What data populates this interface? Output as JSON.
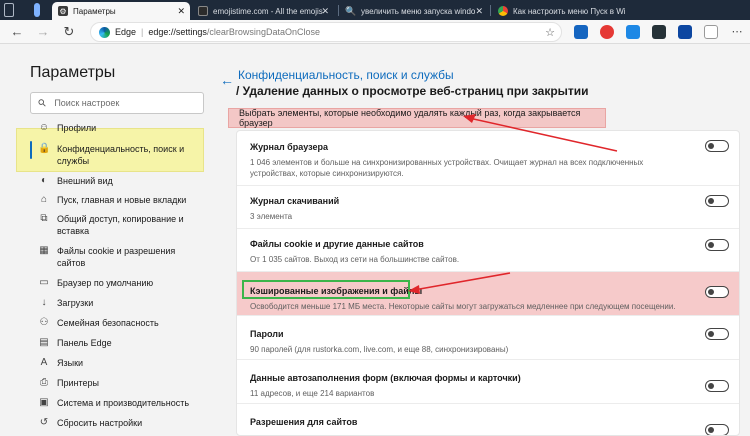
{
  "browser": {
    "tabs": [
      {
        "label": "Параметры",
        "active": true
      },
      {
        "label": "emojistime.com - All the emojis",
        "active": false
      },
      {
        "label": "увеличить меню запуска windo",
        "active": false
      },
      {
        "label": "Как настроить меню Пуск в Wi",
        "active": false
      }
    ],
    "address": {
      "scheme": "Edge",
      "url_host": "edge://settings",
      "url_path": "/clearBrowsingDataOnClose"
    },
    "icons": [
      "back-icon",
      "forward-icon",
      "refresh-icon",
      "home-icon",
      "star-icon",
      "shield-icon",
      "extensions-icon"
    ]
  },
  "settings_nav": {
    "title": "Параметры",
    "search_placeholder": "Поиск настроек",
    "items": [
      {
        "label": "Профили",
        "icon": "person-icon"
      },
      {
        "label": "Конфиденциальность, поиск и службы",
        "icon": "lock-icon"
      },
      {
        "label": "Внешний вид",
        "icon": "appearance-icon"
      },
      {
        "label": "Пуск, главная и новые вкладки",
        "icon": "home-icon"
      },
      {
        "label": "Общий доступ, копирование и вставка",
        "icon": "share-icon"
      },
      {
        "label": "Файлы cookie и разрешения сайтов",
        "icon": "cookie-icon"
      },
      {
        "label": "Браузер по умолчанию",
        "icon": "browser-icon"
      },
      {
        "label": "Загрузки",
        "icon": "download-icon"
      },
      {
        "label": "Семейная безопасность",
        "icon": "family-icon"
      },
      {
        "label": "Панель Edge",
        "icon": "panel-icon"
      },
      {
        "label": "Языки",
        "icon": "language-icon"
      },
      {
        "label": "Принтеры",
        "icon": "printer-icon"
      },
      {
        "label": "Система и производительность",
        "icon": "system-icon"
      },
      {
        "label": "Сбросить настройки",
        "icon": "reset-icon"
      }
    ]
  },
  "main": {
    "breadcrumb": "Конфиденциальность, поиск и службы",
    "page_title": "/ Удаление данных о просмотре веб-страниц при закрытии",
    "instruction": "Выбрать элементы, которые необходимо удалять каждый раз, когда закрывается браузер",
    "rows": [
      {
        "title": "Журнал браузера",
        "desc": "1 046 элементов и больше на синхронизированных устройствах. Очищает журнал на всех подключенных устройствах, которые синхронизируются.",
        "on": false
      },
      {
        "title": "Журнал скачиваний",
        "desc": "3 элемента",
        "on": false
      },
      {
        "title": "Файлы cookie и другие данные сайтов",
        "desc": "От 1 035 сайтов. Выход из сети на большинстве сайтов.",
        "on": false
      },
      {
        "title": "Кэшированные изображения и файлы",
        "desc": "Освободится меньше 171 МБ места. Некоторые сайты могут загружаться медленнее при следующем посещении.",
        "on": false
      },
      {
        "title": "Пароли",
        "desc": "90 паролей (для rustorka.com, live.com, и еще 88, синхронизированы)",
        "on": false
      },
      {
        "title": "Данные автозаполнения форм (включая формы и карточки)",
        "desc": "11 адресов, и еще 214 вариантов",
        "on": false
      },
      {
        "title": "Разрешения для сайтов",
        "desc": "",
        "on": false
      }
    ]
  },
  "colors": {
    "accent": "#0f6cbd",
    "highlight_yellow": "#f6f4a8",
    "highlight_red": "#f6caca",
    "annotation_red": "#e0262b",
    "annotation_green": "#3bb54a"
  }
}
